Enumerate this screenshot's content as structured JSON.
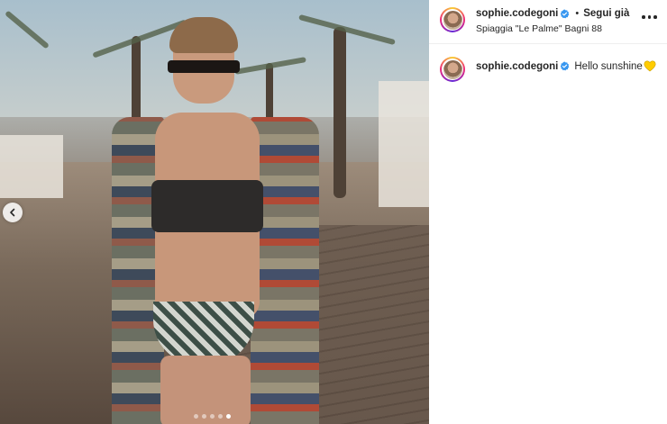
{
  "post": {
    "media": {
      "image_description_icon": "photo",
      "carousel": {
        "total": 5,
        "current": 5
      },
      "prev_icon": "chevron-left-icon"
    },
    "header": {
      "username": "sophie.codegoni",
      "verified_icon": "verified-badge-icon",
      "separator": "•",
      "follow_label": "Segui già",
      "location": "Spiaggia \"Le Palme\" Bagni 88",
      "more_icon": "more-options-icon"
    },
    "caption": {
      "username": "sophie.codegoni",
      "text": "Hello sunshine",
      "emoji_icon": "yellow-heart-icon"
    },
    "colors": {
      "verified": "#3897f0",
      "heart": "#ffcc00",
      "text": "#262626"
    }
  }
}
